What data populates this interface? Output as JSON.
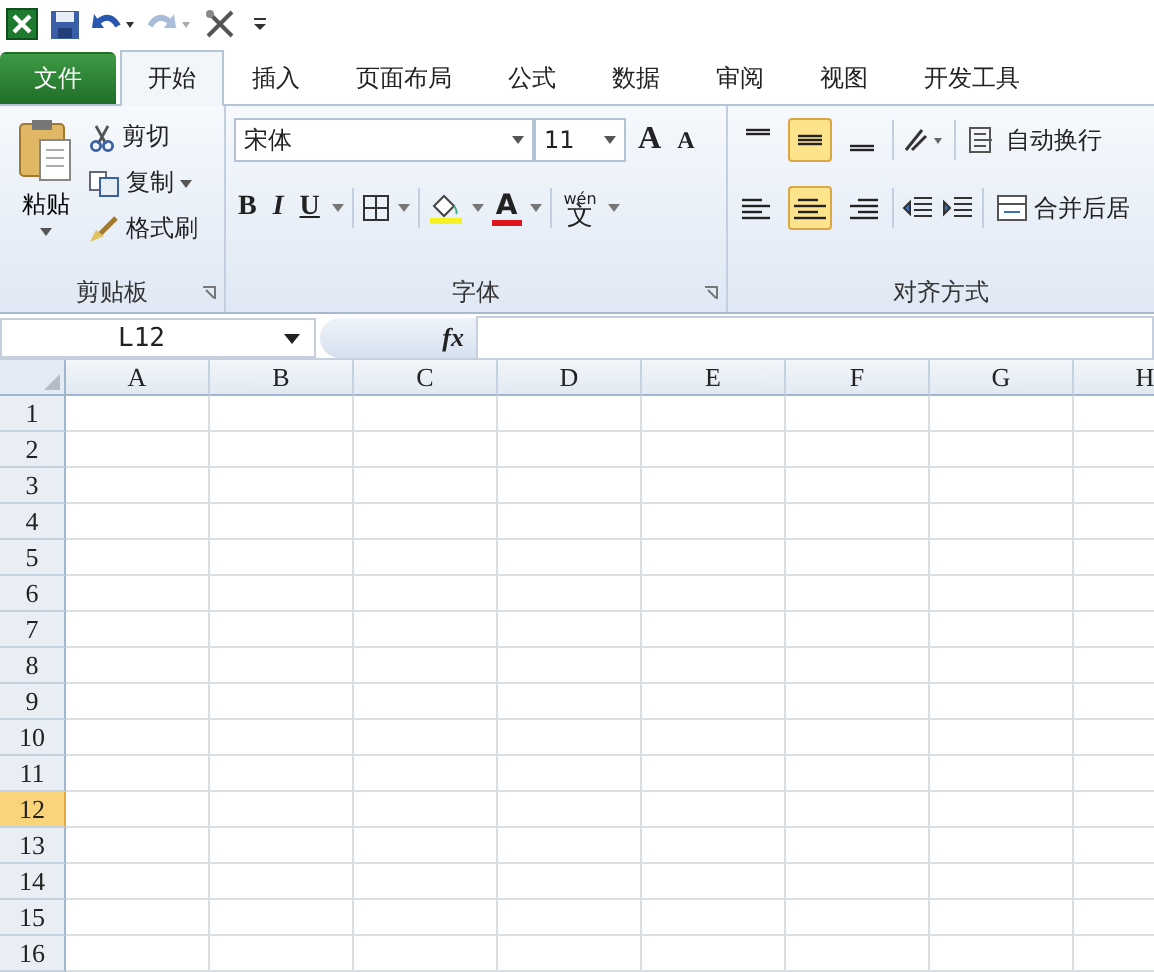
{
  "tabs": [
    {
      "label": "文件",
      "kind": "file",
      "selected": false
    },
    {
      "label": "开始",
      "kind": "tab",
      "selected": true
    },
    {
      "label": "插入",
      "kind": "tab",
      "selected": false
    },
    {
      "label": "页面布局",
      "kind": "tab",
      "selected": false
    },
    {
      "label": "公式",
      "kind": "tab",
      "selected": false
    },
    {
      "label": "数据",
      "kind": "tab",
      "selected": false
    },
    {
      "label": "审阅",
      "kind": "tab",
      "selected": false
    },
    {
      "label": "视图",
      "kind": "tab",
      "selected": false
    },
    {
      "label": "开发工具",
      "kind": "tab",
      "selected": false
    }
  ],
  "clipboard": {
    "paste": "粘贴",
    "cut": "剪切",
    "copy": "复制",
    "format_painter": "格式刷",
    "title": "剪贴板"
  },
  "font": {
    "name": "宋体",
    "size": "11",
    "grow": "A",
    "shrink": "A",
    "bold": "B",
    "italic": "I",
    "underline": "U",
    "font_color": "A",
    "phonetic_top": "wén",
    "phonetic": "文",
    "title": "字体"
  },
  "alignment": {
    "vertical": [
      {
        "kind": "top",
        "selected": false
      },
      {
        "kind": "middle",
        "selected": true
      },
      {
        "kind": "bottom",
        "selected": false
      }
    ],
    "horizontal": [
      {
        "kind": "left",
        "selected": false
      },
      {
        "kind": "center",
        "selected": true
      },
      {
        "kind": "right",
        "selected": false
      }
    ],
    "wrap_text": "自动换行",
    "merge_center": "合并后居",
    "title": "对齐方式"
  },
  "formula_bar": {
    "name_box": "L12",
    "fx": "fx"
  },
  "sheet": {
    "columns": [
      "A",
      "B",
      "C",
      "D",
      "E",
      "F",
      "G",
      "H"
    ],
    "rows": [
      {
        "label": "1",
        "selected": false
      },
      {
        "label": "2",
        "selected": false
      },
      {
        "label": "3",
        "selected": false
      },
      {
        "label": "4",
        "selected": false
      },
      {
        "label": "5",
        "selected": false
      },
      {
        "label": "6",
        "selected": false
      },
      {
        "label": "7",
        "selected": false
      },
      {
        "label": "8",
        "selected": false
      },
      {
        "label": "9",
        "selected": false
      },
      {
        "label": "10",
        "selected": false
      },
      {
        "label": "11",
        "selected": false
      },
      {
        "label": "12",
        "selected": true
      },
      {
        "label": "13",
        "selected": false
      },
      {
        "label": "14",
        "selected": false
      },
      {
        "label": "15",
        "selected": false
      },
      {
        "label": "16",
        "selected": false
      }
    ]
  }
}
